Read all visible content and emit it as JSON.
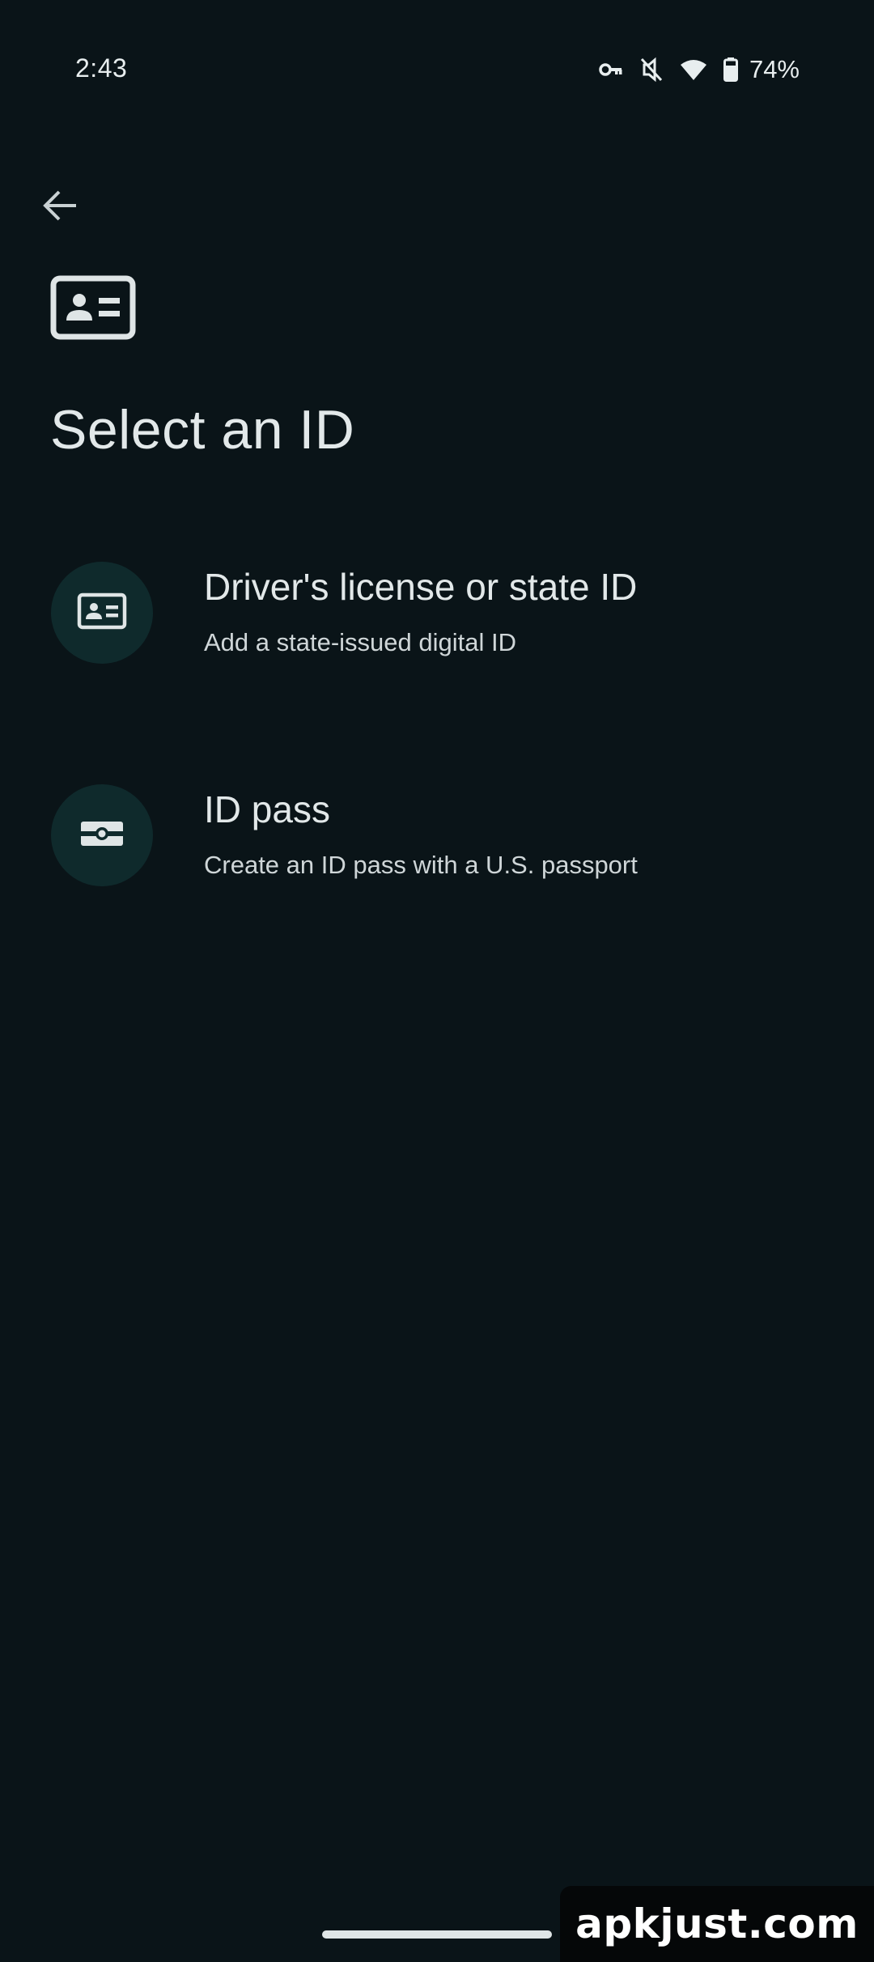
{
  "status_bar": {
    "time": "2:43",
    "battery_percent": "74%",
    "icons": [
      "vpn-key-icon",
      "vibrate-off-icon",
      "wifi-icon",
      "battery-icon"
    ]
  },
  "header": {
    "back_icon": "back-arrow-icon",
    "header_icon": "id-card-icon",
    "title": "Select an ID"
  },
  "options": [
    {
      "icon": "id-card-icon",
      "title": "Driver's license or state ID",
      "subtitle": "Add a state-issued digital ID"
    },
    {
      "icon": "id-pass-icon",
      "title": "ID pass",
      "subtitle": "Create an ID pass with a U.S. passport"
    }
  ],
  "watermark": {
    "text": "apkjust.com"
  },
  "colors": {
    "background": "#0a1418",
    "text_primary": "#e2e8e9",
    "icon_circle": "#0f2a2c"
  }
}
